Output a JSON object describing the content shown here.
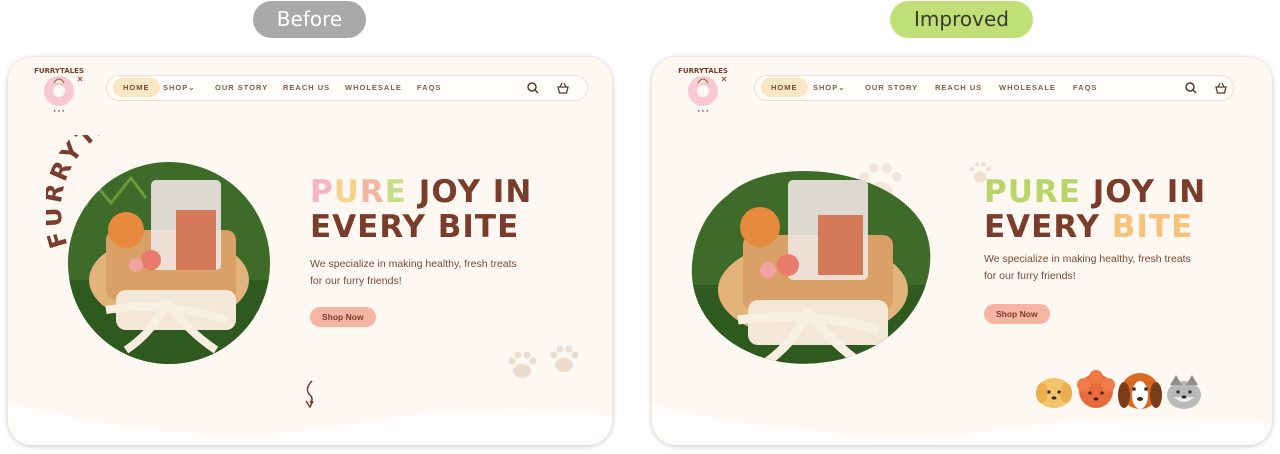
{
  "labels": {
    "before": "Before",
    "after": "Improved"
  },
  "brand": {
    "name": "FURRYTALES"
  },
  "nav": {
    "items": [
      {
        "label": "HOME"
      },
      {
        "label": "SHOP"
      },
      {
        "label": "OUR STORY"
      },
      {
        "label": "REACH US"
      },
      {
        "label": "WHOLESALE"
      },
      {
        "label": "FAQS"
      }
    ],
    "search_icon": "search-icon",
    "cart_icon": "basket-icon"
  },
  "hero": {
    "title_line1": "PURE JOY IN",
    "title_line2": "EVERY BITE",
    "subtitle_line1": "We specialize in making healthy, fresh treats",
    "subtitle_line2": "for our furry friends!",
    "cta": "Shop Now"
  },
  "colors": {
    "card_bg": "#fdf8f1",
    "brown": "#7a3d2c",
    "pink": "#f6b5a3",
    "green": "#c0df76",
    "orange": "#f7c27a",
    "cream": "#fbe7c4"
  }
}
